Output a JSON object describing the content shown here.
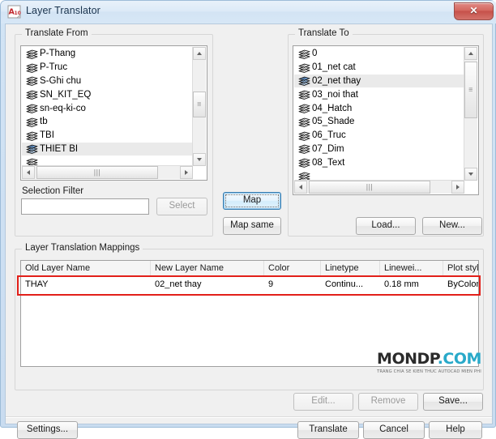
{
  "window": {
    "title": "Layer Translator",
    "app_icon": "autocad-a10-icon",
    "close_label": "✕"
  },
  "translate_from": {
    "group_label": "Translate From",
    "accel": "F",
    "items": [
      {
        "label": "P-Thang",
        "selected": false
      },
      {
        "label": "P-Truc",
        "selected": false
      },
      {
        "label": "S-Ghi chu",
        "selected": false
      },
      {
        "label": "SN_KIT_EQ",
        "selected": false
      },
      {
        "label": "sn-eq-ki-co",
        "selected": false
      },
      {
        "label": "tb",
        "selected": false
      },
      {
        "label": "TBI",
        "selected": false
      },
      {
        "label": "THIET BI",
        "selected": true
      }
    ]
  },
  "translate_to": {
    "group_label": "Translate To",
    "accel": "o",
    "items": [
      {
        "label": "0",
        "selected": false
      },
      {
        "label": "01_net cat",
        "selected": false
      },
      {
        "label": "02_net thay",
        "selected": true
      },
      {
        "label": "03_noi that",
        "selected": false
      },
      {
        "label": "04_Hatch",
        "selected": false
      },
      {
        "label": "05_Shade",
        "selected": false
      },
      {
        "label": "06_Truc",
        "selected": false
      },
      {
        "label": "07_Dim",
        "selected": false
      },
      {
        "label": "08_Text",
        "selected": false
      }
    ]
  },
  "selection_filter": {
    "label": "Selection Filter",
    "accel": "l",
    "value": "",
    "placeholder": "",
    "select_button": "Select",
    "select_accel": "c",
    "select_disabled": true
  },
  "middle_buttons": {
    "map": "Map",
    "map_accel": "M",
    "map_focused": true,
    "map_same": "Map same",
    "map_same_accel": "a"
  },
  "right_buttons": {
    "load": "Load...",
    "load_accel": "L",
    "new": "New...",
    "new_accel": "N"
  },
  "mappings": {
    "group_label": "Layer Translation Mappings",
    "columns": [
      {
        "key": "old_layer_name",
        "label": "Old Layer Name"
      },
      {
        "key": "new_layer_name",
        "label": "New Layer Name"
      },
      {
        "key": "color",
        "label": "Color"
      },
      {
        "key": "linetype",
        "label": "Linetype"
      },
      {
        "key": "lineweight",
        "label": "Linewei..."
      },
      {
        "key": "plot_style",
        "label": "Plot style"
      }
    ],
    "rows": [
      {
        "old_layer_name": "THAY",
        "new_layer_name": "02_net thay",
        "color": "9",
        "linetype": "Continu...",
        "lineweight": "0.18 mm",
        "plot_style": "ByColor",
        "highlighted": true
      }
    ],
    "highlight_color": "#e2201a"
  },
  "table_buttons": {
    "edit": "Edit...",
    "edit_accel": "E",
    "edit_disabled": true,
    "remove": "Remove",
    "remove_accel": "R",
    "remove_disabled": true,
    "save": "Save...",
    "save_accel": "S"
  },
  "footer_buttons": {
    "settings": "Settings...",
    "settings_accel": "g",
    "translate": "Translate",
    "translate_accel": "T",
    "cancel": "Cancel",
    "help": "Help",
    "help_accel": "H"
  },
  "watermark": {
    "main_dark": "MONDP",
    "main_accent": ".COM",
    "tagline": "TRANG CHIA SE KIEN THUC AUTOCAD MIEN PHI",
    "dark_color": "#2b2b2b",
    "accent_color": "#29a9c9"
  }
}
